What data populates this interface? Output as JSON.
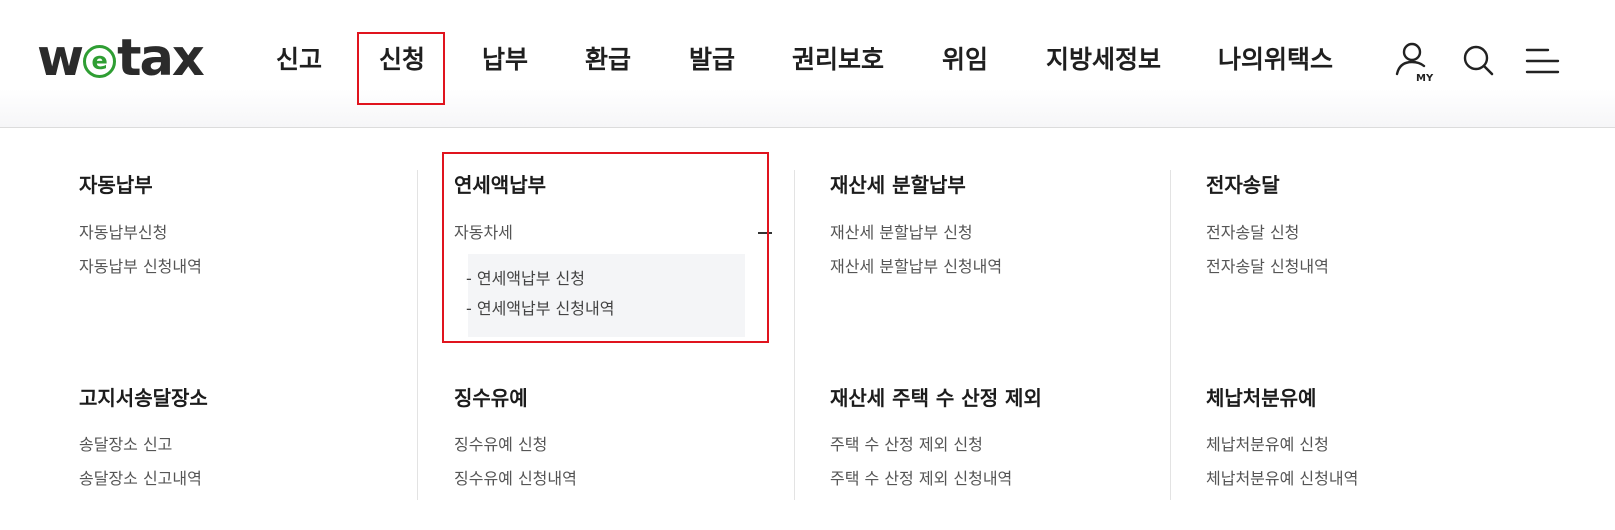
{
  "logo": {
    "prefix": "w",
    "circle_letter": "e",
    "suffix": "tax",
    "brand_green": "#2f9e33"
  },
  "nav": {
    "items": [
      "신고",
      "신청",
      "납부",
      "환급",
      "발급",
      "권리보호",
      "위임",
      "지방세정보",
      "나의위택스"
    ],
    "active_index": 1
  },
  "utility": {
    "my_label": "MY",
    "icons": [
      "user-my-icon",
      "search-icon",
      "menu-icon"
    ]
  },
  "highlight_color": "#e0141e",
  "mega_menu": {
    "row1": [
      {
        "title": "자동납부",
        "links": [
          "자동납부신청",
          "자동납부 신청내역"
        ]
      },
      {
        "title": "연세액납부",
        "expanded": {
          "label": "자동차세",
          "toggle": "−",
          "sub_links": [
            "- 연세액납부 신청",
            "- 연세액납부 신청내역"
          ]
        }
      },
      {
        "title": "재산세 분할납부",
        "links": [
          "재산세 분할납부 신청",
          "재산세 분할납부 신청내역"
        ]
      },
      {
        "title": "전자송달",
        "links": [
          "전자송달 신청",
          "전자송달 신청내역"
        ]
      }
    ],
    "row2": [
      {
        "title": "고지서송달장소",
        "links": [
          "송달장소 신고",
          "송달장소 신고내역"
        ]
      },
      {
        "title": "징수유예",
        "links": [
          "징수유예 신청",
          "징수유예 신청내역"
        ]
      },
      {
        "title": "재산세 주택 수 산정 제외",
        "links": [
          "주택 수 산정 제외 신청",
          "주택 수 산정 제외 신청내역"
        ]
      },
      {
        "title": "체납처분유예",
        "links": [
          "체납처분유예 신청",
          "체납처분유예 신청내역"
        ]
      }
    ]
  }
}
